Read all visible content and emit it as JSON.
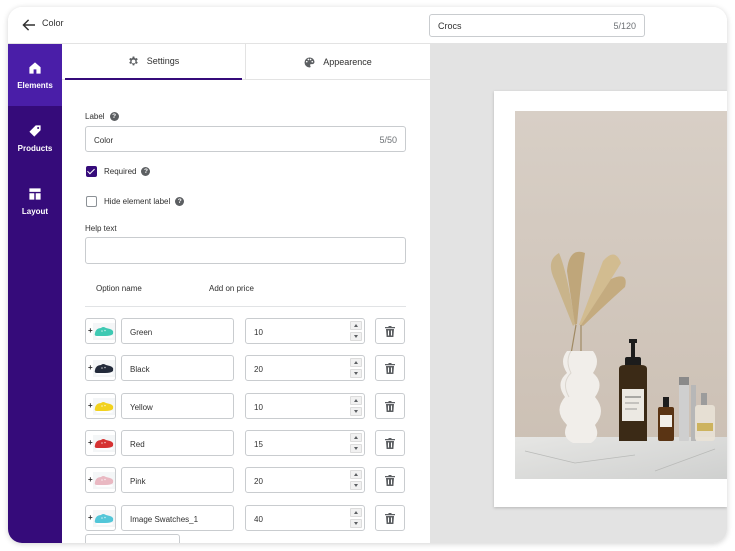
{
  "header": {
    "title": "Color",
    "product_name": "Crocs",
    "product_name_count": "5/120"
  },
  "sidebar": {
    "items": [
      {
        "label": "Elements",
        "icon": "home-icon",
        "active": true
      },
      {
        "label": "Products",
        "icon": "tag-icon",
        "active": false
      },
      {
        "label": "Layout",
        "icon": "layout-icon",
        "active": false
      }
    ]
  },
  "tabs": [
    {
      "label": "Settings",
      "icon": "gear-icon",
      "active": true
    },
    {
      "label": "Appearence",
      "icon": "palette-icon",
      "active": false
    }
  ],
  "form": {
    "label_title": "Label",
    "label_value": "Color",
    "label_count": "5/50",
    "required_label": "Required",
    "required_checked": true,
    "hide_label_label": "Hide element label",
    "hide_label_checked": false,
    "help_text_title": "Help text",
    "help_text_value": ""
  },
  "options": {
    "columns": [
      "Option name",
      "Add on price"
    ],
    "rows": [
      {
        "name": "Green",
        "price": "10",
        "swatch_color": "#3ec9b3"
      },
      {
        "name": "Black",
        "price": "20",
        "swatch_color": "#222a3a"
      },
      {
        "name": "Yellow",
        "price": "10",
        "swatch_color": "#f2d21d"
      },
      {
        "name": "Red",
        "price": "15",
        "swatch_color": "#d63232"
      },
      {
        "name": "Pink",
        "price": "20",
        "swatch_color": "#e9b8c2"
      },
      {
        "name": "Image Swatches_1",
        "price": "40",
        "swatch_color": "#52c6d8"
      }
    ]
  },
  "colors": {
    "sidebar_bg": "#350b7a",
    "sidebar_active": "#4a1ea8",
    "accent": "#350b7a"
  }
}
